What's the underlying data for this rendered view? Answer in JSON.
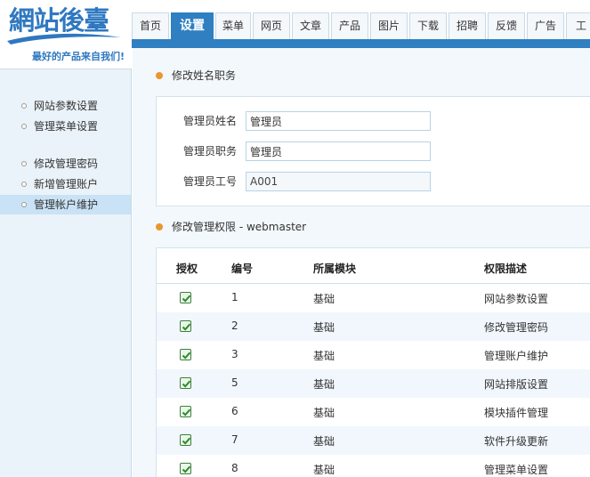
{
  "logo": {
    "title": "網站後臺",
    "slogan": "最好的产品来自我们!"
  },
  "sidebar": {
    "items": [
      {
        "label": "网站参数设置",
        "active": false
      },
      {
        "label": "管理菜单设置",
        "active": false
      },
      {
        "label": "修改管理密码",
        "active": false
      },
      {
        "label": "新增管理账户",
        "active": false
      },
      {
        "label": "管理帐户维护",
        "active": true
      }
    ]
  },
  "nav": {
    "tabs": [
      {
        "label": "首页"
      },
      {
        "label": "设置",
        "active": true
      },
      {
        "label": "菜单"
      },
      {
        "label": "网页"
      },
      {
        "label": "文章"
      },
      {
        "label": "产品"
      },
      {
        "label": "图片"
      },
      {
        "label": "下载"
      },
      {
        "label": "招聘"
      },
      {
        "label": "反馈"
      },
      {
        "label": "广告"
      },
      {
        "label": "工"
      }
    ]
  },
  "form_section": {
    "title": "修改姓名职务",
    "fields": [
      {
        "label": "管理员姓名",
        "value": "管理员",
        "readonly": false
      },
      {
        "label": "管理员职务",
        "value": "管理员",
        "readonly": false
      },
      {
        "label": "管理员工号",
        "value": "A001",
        "readonly": true
      }
    ]
  },
  "perm_section": {
    "title": "修改管理权限 - webmaster",
    "columns": [
      "授权",
      "编号",
      "所属模块",
      "权限描述"
    ],
    "rows": [
      {
        "checked": true,
        "id": "1",
        "module": "基础",
        "desc": "网站参数设置"
      },
      {
        "checked": true,
        "id": "2",
        "module": "基础",
        "desc": "修改管理密码"
      },
      {
        "checked": true,
        "id": "3",
        "module": "基础",
        "desc": "管理账户维护"
      },
      {
        "checked": true,
        "id": "5",
        "module": "基础",
        "desc": "网站排版设置"
      },
      {
        "checked": true,
        "id": "6",
        "module": "基础",
        "desc": "模块插件管理"
      },
      {
        "checked": true,
        "id": "7",
        "module": "基础",
        "desc": "软件升级更新"
      },
      {
        "checked": true,
        "id": "8",
        "module": "基础",
        "desc": "管理菜单设置"
      }
    ]
  },
  "colors": {
    "accent": "#2f7fc1",
    "sidebar_bg": "#eaf3fa",
    "section_bullet": "#e9962e",
    "check_green": "#2e8b2e"
  }
}
